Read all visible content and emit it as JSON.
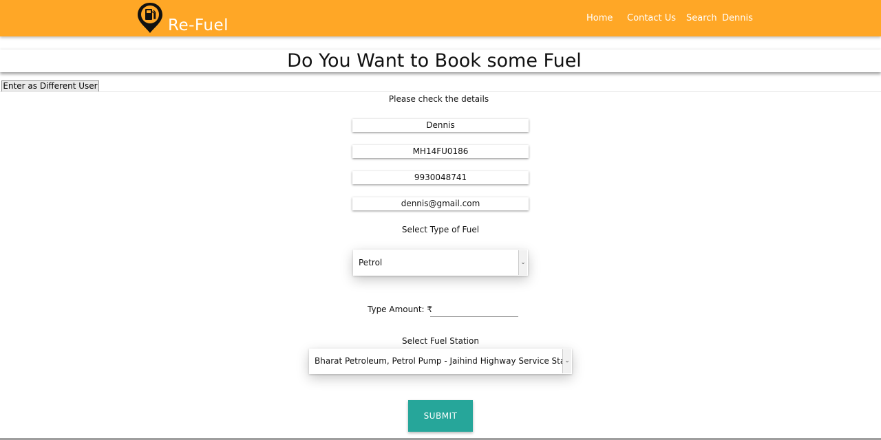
{
  "header": {
    "brand": "Re-Fuel",
    "logo_icon": "fuel-pump-location-pin-icon",
    "nav": {
      "home": "Home",
      "contact": "Contact Us",
      "search": "Search",
      "user": "Dennis"
    }
  },
  "page": {
    "title": "Do You Want to Book some Fuel",
    "different_user_button": "Enter as Different User",
    "check_details_label": "Please check the details"
  },
  "details": {
    "name": "Dennis",
    "vehicle_number": "MH14FU0186",
    "phone": "9930048741",
    "email": "dennis@gmail.com"
  },
  "fuel_type": {
    "label": "Select Type of Fuel",
    "selected": "Petrol"
  },
  "amount": {
    "label": "Type Amount: ₹",
    "value": ""
  },
  "station": {
    "label": "Select Fuel Station",
    "selected": "Bharat Petroleum, Petrol Pump - Jaihind Highway Service Station"
  },
  "submit_label": "SUBMIT",
  "colors": {
    "header_bg": "#ffa726",
    "submit_bg": "#26a69a"
  }
}
